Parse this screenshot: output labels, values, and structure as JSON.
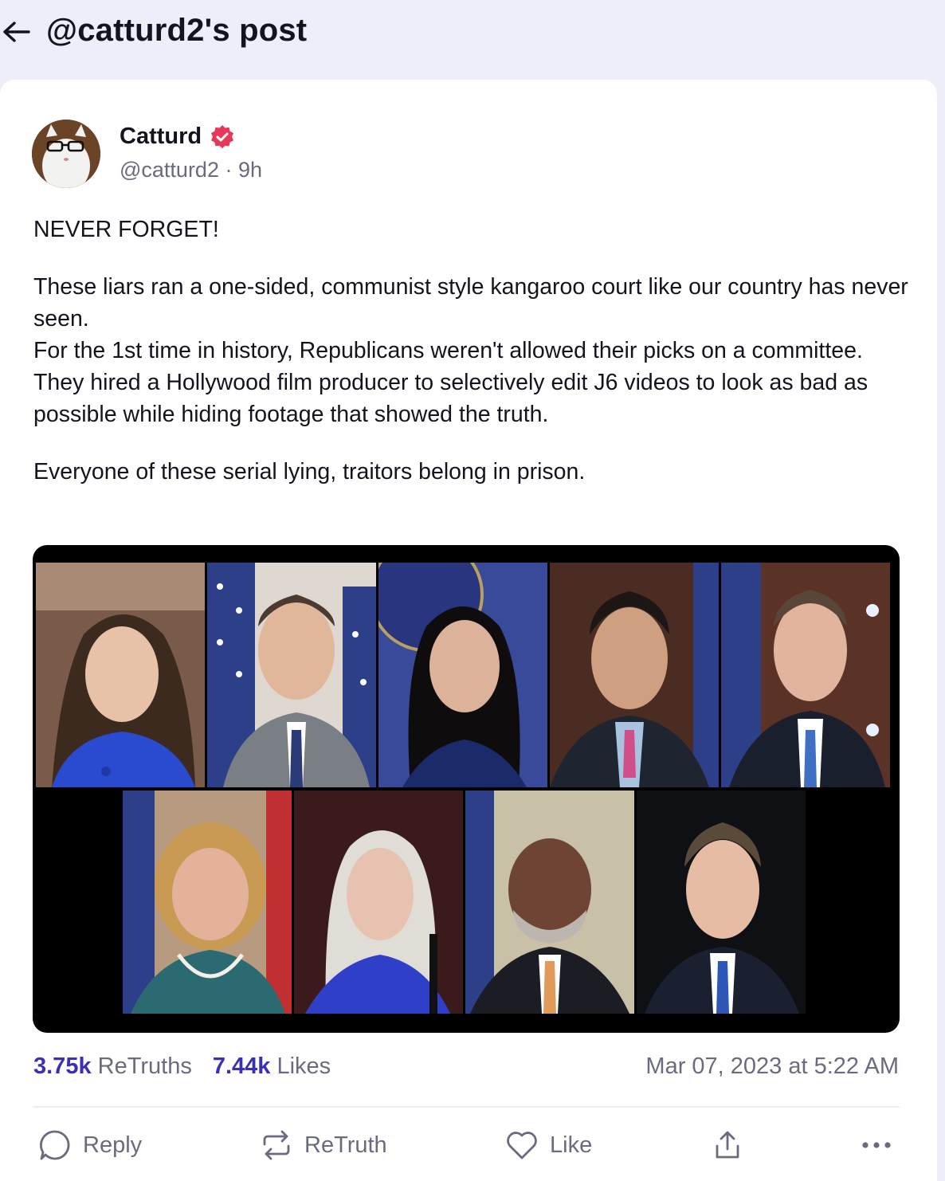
{
  "header": {
    "title": "@catturd2's post"
  },
  "post": {
    "author_name": "Catturd",
    "handle_line": "@catturd2 · 9h",
    "paragraphs": [
      "NEVER FORGET!",
      "These liars ran a one-sided, communist style kangaroo court like our country has never seen.\nFor the 1st time in history, Republicans weren't allowed their picks on a committee.\nThey hired a Hollywood film producer to selectively edit J6 videos to look as bad as possible while hiding footage that showed the truth.",
      "Everyone of these serial lying, traitors belong in prison."
    ],
    "retruths_count": "3.75k",
    "retruths_label": "ReTruths",
    "likes_count": "7.44k",
    "likes_label": "Likes",
    "timestamp": "Mar 07, 2023 at 5:22 AM"
  },
  "actions": {
    "reply": "Reply",
    "retruth": "ReTruth",
    "like": "Like"
  },
  "colors": {
    "accent": "#3b2fb5",
    "verified": "#e8385a",
    "muted": "#6b6b80",
    "background": "#eeeef8"
  },
  "icons": [
    "back-arrow-icon",
    "verified-badge-icon",
    "reply-icon",
    "retruth-icon",
    "like-icon",
    "share-icon",
    "more-icon"
  ]
}
